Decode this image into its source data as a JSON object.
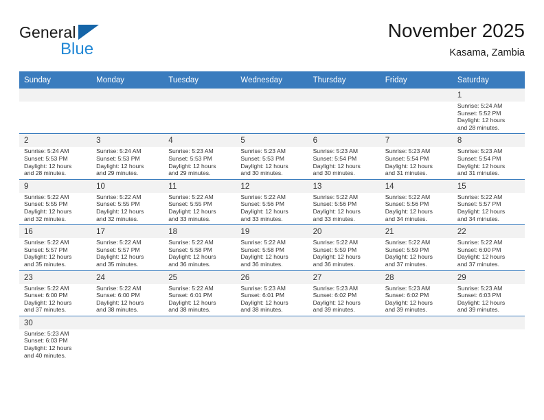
{
  "logo": {
    "primary_text": "General",
    "secondary_text": "Blue",
    "triangle_color": "#1565a8",
    "secondary_color": "#2288d6"
  },
  "header": {
    "title": "November 2025",
    "subtitle": "Kasama, Zambia"
  },
  "theme": {
    "header_row_bg": "#3a7cbe",
    "cell_shade_bg": "#f2f2f2",
    "grid_line": "#3a7cbe"
  },
  "weekday_headers": [
    "Sunday",
    "Monday",
    "Tuesday",
    "Wednesday",
    "Thursday",
    "Friday",
    "Saturday"
  ],
  "weeks": [
    [
      {
        "day": "",
        "sunrise": "",
        "sunset": "",
        "daylight_line1": "",
        "daylight_line2": "",
        "empty": true
      },
      {
        "day": "",
        "sunrise": "",
        "sunset": "",
        "daylight_line1": "",
        "daylight_line2": "",
        "empty": true
      },
      {
        "day": "",
        "sunrise": "",
        "sunset": "",
        "daylight_line1": "",
        "daylight_line2": "",
        "empty": true
      },
      {
        "day": "",
        "sunrise": "",
        "sunset": "",
        "daylight_line1": "",
        "daylight_line2": "",
        "empty": true
      },
      {
        "day": "",
        "sunrise": "",
        "sunset": "",
        "daylight_line1": "",
        "daylight_line2": "",
        "empty": true
      },
      {
        "day": "",
        "sunrise": "",
        "sunset": "",
        "daylight_line1": "",
        "daylight_line2": "",
        "empty": true
      },
      {
        "day": "1",
        "sunrise": "Sunrise: 5:24 AM",
        "sunset": "Sunset: 5:52 PM",
        "daylight_line1": "Daylight: 12 hours",
        "daylight_line2": "and 28 minutes."
      }
    ],
    [
      {
        "day": "2",
        "sunrise": "Sunrise: 5:24 AM",
        "sunset": "Sunset: 5:53 PM",
        "daylight_line1": "Daylight: 12 hours",
        "daylight_line2": "and 28 minutes."
      },
      {
        "day": "3",
        "sunrise": "Sunrise: 5:24 AM",
        "sunset": "Sunset: 5:53 PM",
        "daylight_line1": "Daylight: 12 hours",
        "daylight_line2": "and 29 minutes."
      },
      {
        "day": "4",
        "sunrise": "Sunrise: 5:23 AM",
        "sunset": "Sunset: 5:53 PM",
        "daylight_line1": "Daylight: 12 hours",
        "daylight_line2": "and 29 minutes."
      },
      {
        "day": "5",
        "sunrise": "Sunrise: 5:23 AM",
        "sunset": "Sunset: 5:53 PM",
        "daylight_line1": "Daylight: 12 hours",
        "daylight_line2": "and 30 minutes."
      },
      {
        "day": "6",
        "sunrise": "Sunrise: 5:23 AM",
        "sunset": "Sunset: 5:54 PM",
        "daylight_line1": "Daylight: 12 hours",
        "daylight_line2": "and 30 minutes."
      },
      {
        "day": "7",
        "sunrise": "Sunrise: 5:23 AM",
        "sunset": "Sunset: 5:54 PM",
        "daylight_line1": "Daylight: 12 hours",
        "daylight_line2": "and 31 minutes."
      },
      {
        "day": "8",
        "sunrise": "Sunrise: 5:23 AM",
        "sunset": "Sunset: 5:54 PM",
        "daylight_line1": "Daylight: 12 hours",
        "daylight_line2": "and 31 minutes."
      }
    ],
    [
      {
        "day": "9",
        "sunrise": "Sunrise: 5:22 AM",
        "sunset": "Sunset: 5:55 PM",
        "daylight_line1": "Daylight: 12 hours",
        "daylight_line2": "and 32 minutes."
      },
      {
        "day": "10",
        "sunrise": "Sunrise: 5:22 AM",
        "sunset": "Sunset: 5:55 PM",
        "daylight_line1": "Daylight: 12 hours",
        "daylight_line2": "and 32 minutes."
      },
      {
        "day": "11",
        "sunrise": "Sunrise: 5:22 AM",
        "sunset": "Sunset: 5:55 PM",
        "daylight_line1": "Daylight: 12 hours",
        "daylight_line2": "and 33 minutes."
      },
      {
        "day": "12",
        "sunrise": "Sunrise: 5:22 AM",
        "sunset": "Sunset: 5:56 PM",
        "daylight_line1": "Daylight: 12 hours",
        "daylight_line2": "and 33 minutes."
      },
      {
        "day": "13",
        "sunrise": "Sunrise: 5:22 AM",
        "sunset": "Sunset: 5:56 PM",
        "daylight_line1": "Daylight: 12 hours",
        "daylight_line2": "and 33 minutes."
      },
      {
        "day": "14",
        "sunrise": "Sunrise: 5:22 AM",
        "sunset": "Sunset: 5:56 PM",
        "daylight_line1": "Daylight: 12 hours",
        "daylight_line2": "and 34 minutes."
      },
      {
        "day": "15",
        "sunrise": "Sunrise: 5:22 AM",
        "sunset": "Sunset: 5:57 PM",
        "daylight_line1": "Daylight: 12 hours",
        "daylight_line2": "and 34 minutes."
      }
    ],
    [
      {
        "day": "16",
        "sunrise": "Sunrise: 5:22 AM",
        "sunset": "Sunset: 5:57 PM",
        "daylight_line1": "Daylight: 12 hours",
        "daylight_line2": "and 35 minutes."
      },
      {
        "day": "17",
        "sunrise": "Sunrise: 5:22 AM",
        "sunset": "Sunset: 5:57 PM",
        "daylight_line1": "Daylight: 12 hours",
        "daylight_line2": "and 35 minutes."
      },
      {
        "day": "18",
        "sunrise": "Sunrise: 5:22 AM",
        "sunset": "Sunset: 5:58 PM",
        "daylight_line1": "Daylight: 12 hours",
        "daylight_line2": "and 36 minutes."
      },
      {
        "day": "19",
        "sunrise": "Sunrise: 5:22 AM",
        "sunset": "Sunset: 5:58 PM",
        "daylight_line1": "Daylight: 12 hours",
        "daylight_line2": "and 36 minutes."
      },
      {
        "day": "20",
        "sunrise": "Sunrise: 5:22 AM",
        "sunset": "Sunset: 5:59 PM",
        "daylight_line1": "Daylight: 12 hours",
        "daylight_line2": "and 36 minutes."
      },
      {
        "day": "21",
        "sunrise": "Sunrise: 5:22 AM",
        "sunset": "Sunset: 5:59 PM",
        "daylight_line1": "Daylight: 12 hours",
        "daylight_line2": "and 37 minutes."
      },
      {
        "day": "22",
        "sunrise": "Sunrise: 5:22 AM",
        "sunset": "Sunset: 6:00 PM",
        "daylight_line1": "Daylight: 12 hours",
        "daylight_line2": "and 37 minutes."
      }
    ],
    [
      {
        "day": "23",
        "sunrise": "Sunrise: 5:22 AM",
        "sunset": "Sunset: 6:00 PM",
        "daylight_line1": "Daylight: 12 hours",
        "daylight_line2": "and 37 minutes."
      },
      {
        "day": "24",
        "sunrise": "Sunrise: 5:22 AM",
        "sunset": "Sunset: 6:00 PM",
        "daylight_line1": "Daylight: 12 hours",
        "daylight_line2": "and 38 minutes."
      },
      {
        "day": "25",
        "sunrise": "Sunrise: 5:22 AM",
        "sunset": "Sunset: 6:01 PM",
        "daylight_line1": "Daylight: 12 hours",
        "daylight_line2": "and 38 minutes."
      },
      {
        "day": "26",
        "sunrise": "Sunrise: 5:23 AM",
        "sunset": "Sunset: 6:01 PM",
        "daylight_line1": "Daylight: 12 hours",
        "daylight_line2": "and 38 minutes."
      },
      {
        "day": "27",
        "sunrise": "Sunrise: 5:23 AM",
        "sunset": "Sunset: 6:02 PM",
        "daylight_line1": "Daylight: 12 hours",
        "daylight_line2": "and 39 minutes."
      },
      {
        "day": "28",
        "sunrise": "Sunrise: 5:23 AM",
        "sunset": "Sunset: 6:02 PM",
        "daylight_line1": "Daylight: 12 hours",
        "daylight_line2": "and 39 minutes."
      },
      {
        "day": "29",
        "sunrise": "Sunrise: 5:23 AM",
        "sunset": "Sunset: 6:03 PM",
        "daylight_line1": "Daylight: 12 hours",
        "daylight_line2": "and 39 minutes."
      }
    ],
    [
      {
        "day": "30",
        "sunrise": "Sunrise: 5:23 AM",
        "sunset": "Sunset: 6:03 PM",
        "daylight_line1": "Daylight: 12 hours",
        "daylight_line2": "and 40 minutes."
      },
      {
        "day": "",
        "sunrise": "",
        "sunset": "",
        "daylight_line1": "",
        "daylight_line2": "",
        "empty": true
      },
      {
        "day": "",
        "sunrise": "",
        "sunset": "",
        "daylight_line1": "",
        "daylight_line2": "",
        "empty": true
      },
      {
        "day": "",
        "sunrise": "",
        "sunset": "",
        "daylight_line1": "",
        "daylight_line2": "",
        "empty": true
      },
      {
        "day": "",
        "sunrise": "",
        "sunset": "",
        "daylight_line1": "",
        "daylight_line2": "",
        "empty": true
      },
      {
        "day": "",
        "sunrise": "",
        "sunset": "",
        "daylight_line1": "",
        "daylight_line2": "",
        "empty": true
      },
      {
        "day": "",
        "sunrise": "",
        "sunset": "",
        "daylight_line1": "",
        "daylight_line2": "",
        "empty": true
      }
    ]
  ]
}
